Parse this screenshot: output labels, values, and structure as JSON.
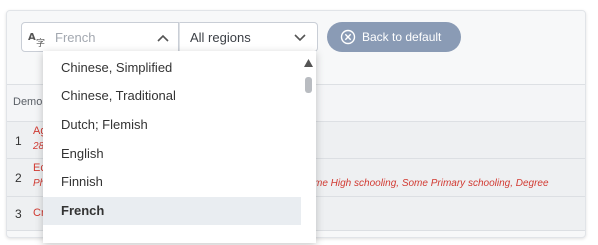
{
  "toolbar": {
    "language_placeholder": "French",
    "region_value": "All regions",
    "back_button_label": "Back to default"
  },
  "table": {
    "header": "Demo",
    "rows": [
      {
        "num": "1",
        "line1": "Ag",
        "line2": "28"
      },
      {
        "num": "2",
        "line1": "Ec",
        "line2": "Ph",
        "trailing": "me High schooling, Some Primary schooling, Degree"
      },
      {
        "num": "3",
        "line1": "Cr"
      }
    ]
  },
  "dropdown": {
    "items": [
      "Chinese, Simplified",
      "Chinese, Traditional",
      "Dutch; Flemish",
      "English",
      "Finnish",
      "French"
    ],
    "selected": "French"
  },
  "colors": {
    "accent": "#8a9bb5",
    "error_text": "#d23a32",
    "selected_bg": "#e9edf1"
  },
  "icons": {
    "language": "translate-icon",
    "chevron_up": "chevron-up-icon",
    "chevron_down": "chevron-down-icon",
    "back": "close-circle-icon",
    "scroll_up": "scroll-up-arrow-icon"
  }
}
